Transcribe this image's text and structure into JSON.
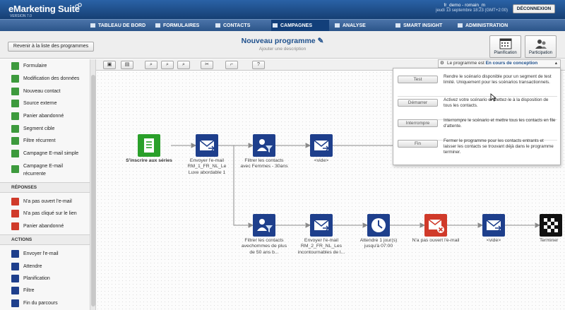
{
  "app": {
    "name": "eMarketing Suite",
    "version": "VERSION 7.0"
  },
  "user": {
    "name": "fr_demo - romain_m",
    "date": "jeudi 13 septembre 18:23 (GMT+2:00)"
  },
  "header": {
    "logout_label": "DÉCONNEXION"
  },
  "nav": {
    "items": [
      {
        "label": "TABLEAU DE BORD"
      },
      {
        "label": "FORMULAIRES"
      },
      {
        "label": "CONTACTS"
      },
      {
        "label": "CAMPAGNES"
      },
      {
        "label": "ANALYSE"
      },
      {
        "label": "SMART INSIGHT"
      },
      {
        "label": "ADMINISTRATION"
      }
    ]
  },
  "page": {
    "back_label": "Revenir à la liste des programmes",
    "title": "Nouveau programme",
    "subtitle": "Ajouter une description",
    "planning_label": "Planification",
    "participation_label": "Participation"
  },
  "sidebar": {
    "entrees": [
      {
        "label": "Formulaire",
        "color": "#3d9a3d"
      },
      {
        "label": "Modification des données",
        "color": "#3d9a3d"
      },
      {
        "label": "Nouveau contact",
        "color": "#3d9a3d"
      },
      {
        "label": "Source externe",
        "color": "#3d9a3d"
      },
      {
        "label": "Panier abandonné",
        "color": "#3d9a3d"
      },
      {
        "label": "Segment cible",
        "color": "#3d9a3d"
      },
      {
        "label": "Filtre récurrent",
        "color": "#3d9a3d"
      },
      {
        "label": "Campagne E-mail simple",
        "color": "#3d9a3d"
      },
      {
        "label": "Campagne E-mail",
        "label2": "récurrente",
        "color": "#3d9a3d"
      }
    ],
    "reponses_title": "RÉPONSES",
    "reponses": [
      {
        "label": "N'a pas ouvert l'e-mail",
        "color": "#d03a2a"
      },
      {
        "label": "N'a pas cliqué sur le lien",
        "color": "#d03a2a"
      },
      {
        "label": "Panier abandonné",
        "color": "#d03a2a"
      }
    ],
    "actions_title": "ACTIONS",
    "actions": [
      {
        "label": "Envoyer l'e-mail",
        "color": "#1e3f8c"
      },
      {
        "label": "Attendre",
        "color": "#1e3f8c"
      },
      {
        "label": "Planification",
        "color": "#1e3f8c"
      },
      {
        "label": "Filtre",
        "color": "#1e3f8c"
      },
      {
        "label": "Fin du parcours",
        "color": "#1e3f8c"
      }
    ]
  },
  "toolbar": {
    "help_label": "?"
  },
  "status": {
    "prefix": "Le programme est",
    "value": "En cours de conception"
  },
  "popup": {
    "rows": [
      {
        "button": "Test",
        "text": "Rendre le scénario disponible pour un segment de test limité. Uniquement pour les scénarios transactionnels."
      },
      {
        "button": "Démarrer",
        "text": "Activez votre scénario et mettez-le à la disposition de tous les contacts."
      },
      {
        "button": "Interrompre",
        "text": "Interrompre le scénario et mettre tous les contacts en file d'attente."
      },
      {
        "button": "Fin",
        "text": "Fermer le programme pour les contacts entrants et laisser les contacts se trouvant déjà dans le programme terminer."
      }
    ]
  },
  "flow": {
    "n1": {
      "label": "S'inscrire aux séries",
      "kind": "form-icon",
      "color": "#2aa02a"
    },
    "n2": {
      "label": "Envoyer l'e-mail RM_1_FR_NL_Le Luxe abordable 1",
      "kind": "email-icon",
      "color": "#1e3f8c"
    },
    "n3": {
      "label": "Filtrer les contacts avec Femmes - 30ans",
      "kind": "filter-icon",
      "color": "#1e3f8c"
    },
    "n4": {
      "label": "<vide>",
      "kind": "email-icon",
      "color": "#1e3f8c"
    },
    "n5": {
      "label": "Filtrer les contacts avechommes de plus de 50 ans b...",
      "kind": "filter-icon",
      "color": "#1e3f8c"
    },
    "n6": {
      "label": "Envoyer l'e-mail RM_2_FR_NL_Les incontournables de l...",
      "kind": "email-icon",
      "color": "#1e3f8c"
    },
    "n7": {
      "label": "Attendre 1 jour(s) jusqu'à 07:00",
      "kind": "clock-icon",
      "color": "#1e3f8c"
    },
    "n8": {
      "label": "N'a pas ouvert l'e-mail",
      "kind": "email-not-opened-icon",
      "color": "#d03a2a"
    },
    "n9": {
      "label": "<vide>",
      "kind": "email-icon",
      "color": "#1e3f8c"
    },
    "n10": {
      "label": "Terminer",
      "kind": "finish-flag-icon",
      "color": "#111111"
    }
  }
}
